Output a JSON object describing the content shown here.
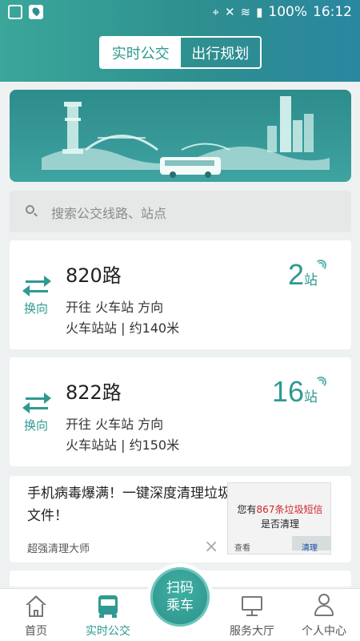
{
  "status_bar": {
    "battery": "100%",
    "time": "16:12"
  },
  "header": {
    "tabs": [
      {
        "label": "实时公交",
        "active": true
      },
      {
        "label": "出行规划",
        "active": false
      }
    ]
  },
  "search": {
    "placeholder": "搜索公交线路、站点"
  },
  "routes": [
    {
      "swap_label": "换向",
      "name": "820路",
      "direction": "开往 火车站 方向",
      "station_distance": "火车站站 | 约140米",
      "stops": "2",
      "stops_unit": "站"
    },
    {
      "swap_label": "换向",
      "name": "822路",
      "direction": "开往 火车站 方向",
      "station_distance": "火车站站 | 约150米",
      "stops": "16",
      "stops_unit": "站"
    }
  ],
  "ad": {
    "title": "手机病毒爆满！一键深度清理垃圾文件！",
    "source": "超强清理大师",
    "close": "×",
    "image": {
      "line1_prefix": "您有",
      "line1_count": "867",
      "line1_suffix": "条垃圾短信",
      "line2": "是否清理",
      "btn_view": "查看",
      "btn_clean": "清理"
    }
  },
  "bottom_nav": {
    "items": [
      {
        "label": "首页"
      },
      {
        "label": "实时公交"
      },
      {
        "label": "服务大厅"
      },
      {
        "label": "个人中心"
      }
    ],
    "scan_line1": "扫码",
    "scan_line2": "乘车"
  },
  "colors": {
    "accent": "#2e9a91",
    "header_start": "#3aa79a",
    "header_end": "#2a87a0",
    "highlight_red": "#d0252c"
  }
}
